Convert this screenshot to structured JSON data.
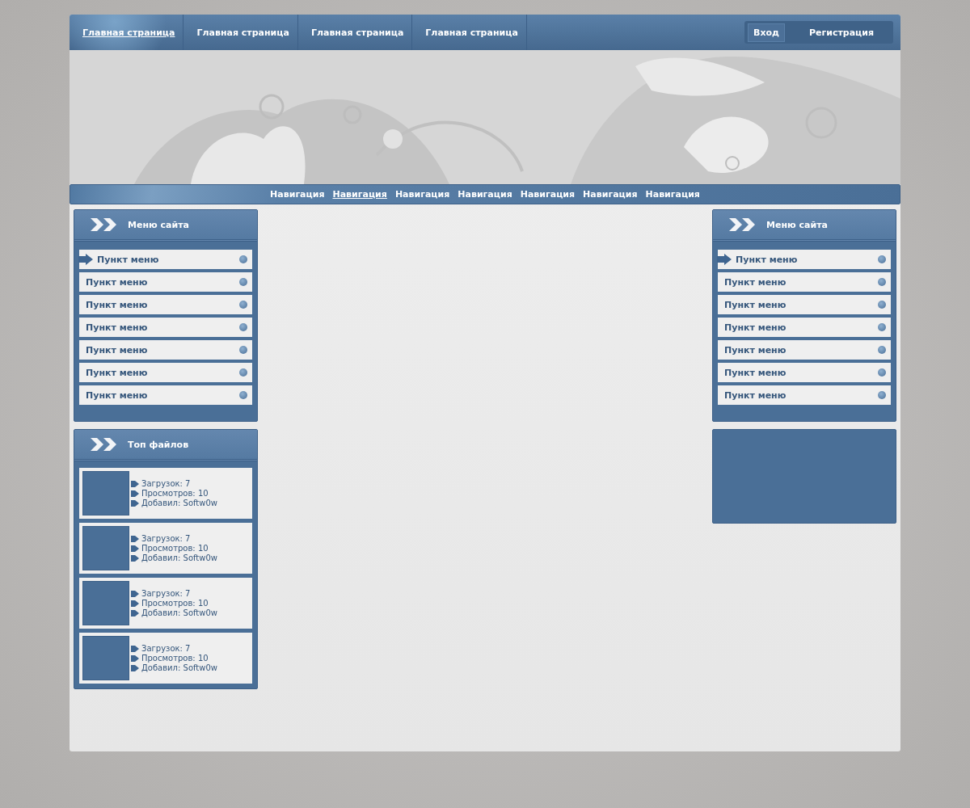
{
  "top_tabs": [
    {
      "label": "Главная страница",
      "selected": true
    },
    {
      "label": "Главная страница",
      "selected": false
    },
    {
      "label": "Главная страница",
      "selected": false
    },
    {
      "label": "Главная страница",
      "selected": false
    }
  ],
  "auth": [
    {
      "label": "Вход",
      "selected": true
    },
    {
      "label": "Регистрация",
      "selected": false
    }
  ],
  "navigation": [
    {
      "label": "Навигация",
      "selected": false
    },
    {
      "label": "Навигация",
      "selected": true
    },
    {
      "label": "Навигация",
      "selected": false
    },
    {
      "label": "Навигация",
      "selected": false
    },
    {
      "label": "Навигация",
      "selected": false
    },
    {
      "label": "Навигация",
      "selected": false
    },
    {
      "label": "Навигация",
      "selected": false
    }
  ],
  "left_menu": {
    "title": "Меню сайта",
    "items": [
      {
        "label": "Пункт меню",
        "selected": true
      },
      {
        "label": "Пункт меню",
        "selected": false
      },
      {
        "label": "Пункт меню",
        "selected": false
      },
      {
        "label": "Пункт меню",
        "selected": false
      },
      {
        "label": "Пункт меню",
        "selected": false
      },
      {
        "label": "Пункт меню",
        "selected": false
      },
      {
        "label": "Пункт меню",
        "selected": false
      }
    ]
  },
  "top_files": {
    "title": "Топ файлов",
    "items": [
      {
        "lines": [
          "Загрузок: 7",
          "Просмотров: 10",
          "Добавил: Softw0w"
        ]
      },
      {
        "lines": [
          "Загрузок: 7",
          "Просмотров: 10",
          "Добавил: Softw0w"
        ]
      },
      {
        "lines": [
          "Загрузок: 7",
          "Просмотров: 10",
          "Добавил: Softw0w"
        ]
      },
      {
        "lines": [
          "Загрузок: 7",
          "Просмотров: 10",
          "Добавил: Softw0w"
        ]
      }
    ]
  },
  "right_menu": {
    "title": "Меню сайта",
    "items": [
      {
        "label": "Пункт меню",
        "selected": true
      },
      {
        "label": "Пункт меню",
        "selected": false
      },
      {
        "label": "Пункт меню",
        "selected": false
      },
      {
        "label": "Пункт меню",
        "selected": false
      },
      {
        "label": "Пункт меню",
        "selected": false
      },
      {
        "label": "Пункт меню",
        "selected": false
      },
      {
        "label": "Пункт меню",
        "selected": false
      }
    ]
  }
}
